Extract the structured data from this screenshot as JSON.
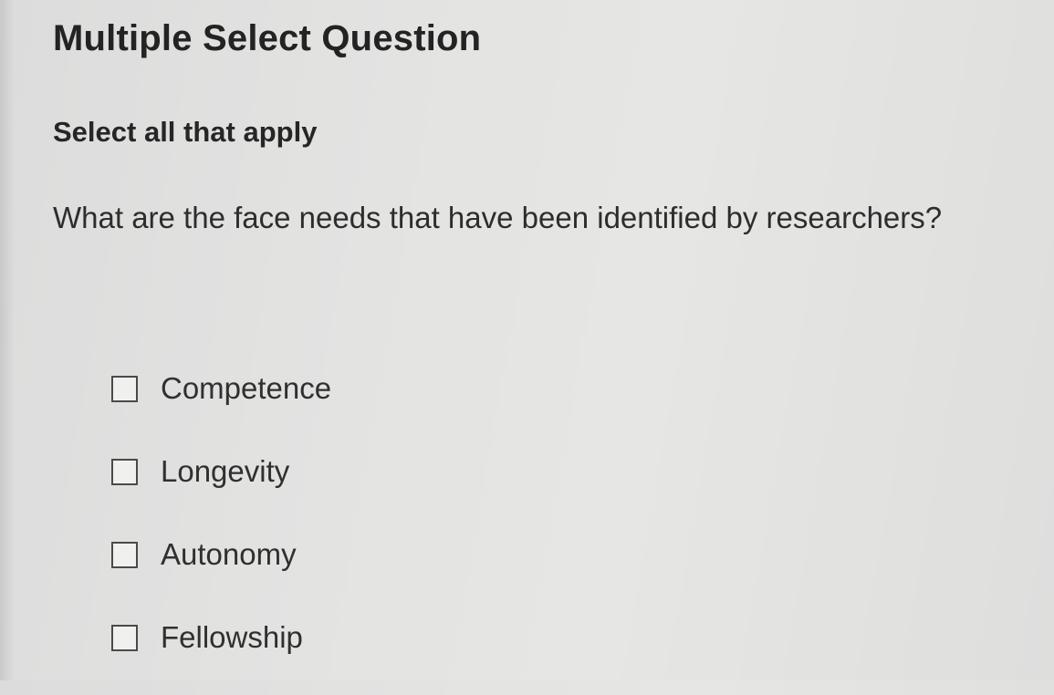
{
  "question": {
    "type_label": "Multiple Select Question",
    "instruction": "Select all that apply",
    "prompt": "What are the face needs that have been identified by researchers?"
  },
  "options": [
    {
      "label": "Competence",
      "checked": false
    },
    {
      "label": "Longevity",
      "checked": false
    },
    {
      "label": "Autonomy",
      "checked": false
    },
    {
      "label": "Fellowship",
      "checked": false
    }
  ],
  "colors": {
    "background": "#e3e3e2",
    "text": "#2b2b2b",
    "checkbox_border": "#4a4a4a"
  }
}
